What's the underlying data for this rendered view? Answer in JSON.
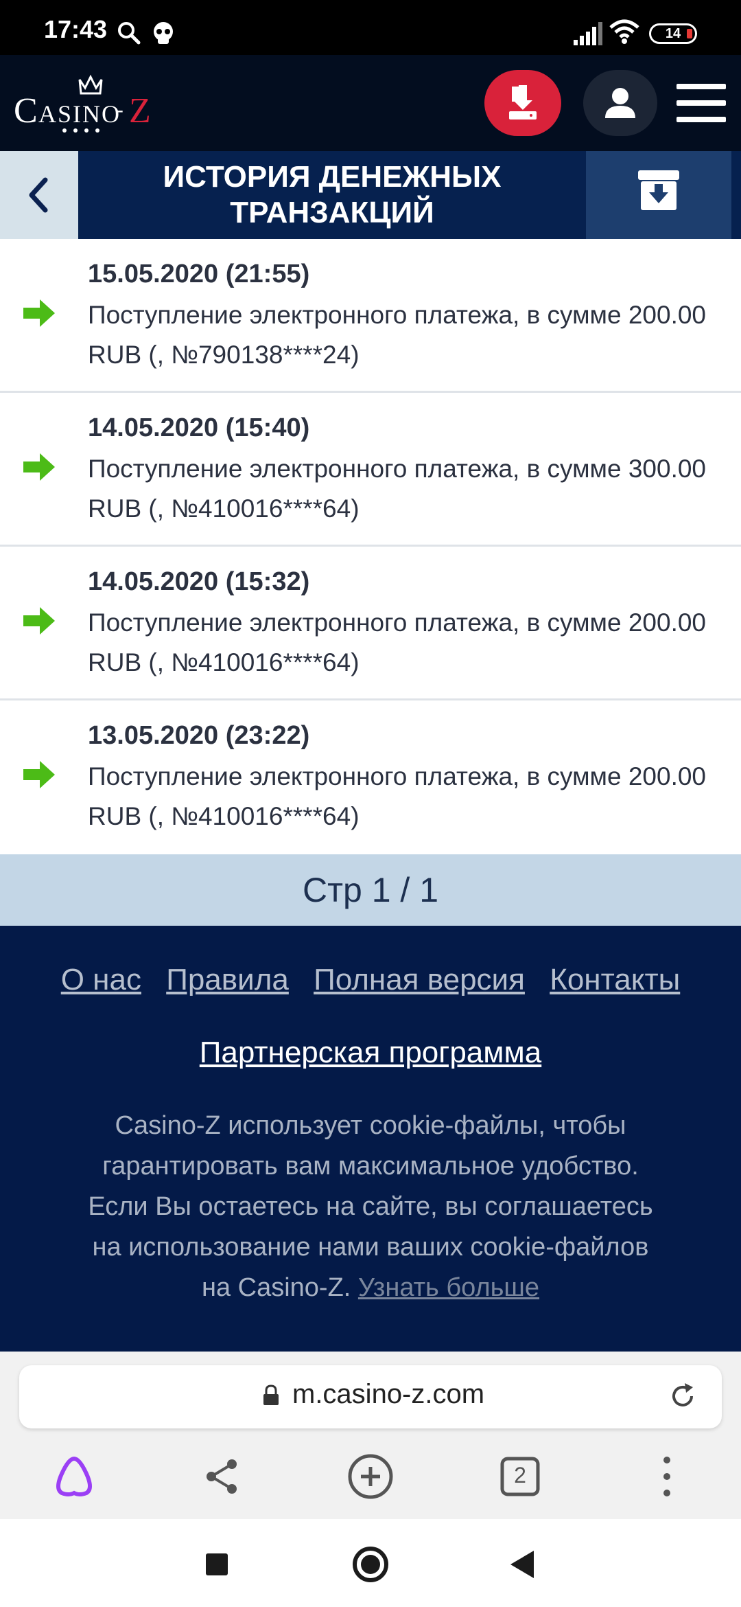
{
  "status_bar": {
    "time": "17:43",
    "battery": "14"
  },
  "header": {
    "logo_text": "CASINO-Z"
  },
  "page": {
    "title": "ИСТОРИЯ ДЕНЕЖНЫХ ТРАНЗАКЦИЙ"
  },
  "transactions": [
    {
      "date": "15.05.2020 (21:55)",
      "description": "Поступление электронного платежа, в сумме 200.00 RUB (, №790138****24)"
    },
    {
      "date": "14.05.2020 (15:40)",
      "description": "Поступление электронного платежа, в сумме 300.00 RUB (, №410016****64)"
    },
    {
      "date": "14.05.2020 (15:32)",
      "description": "Поступление электронного платежа, в сумме 200.00 RUB (, №410016****64)"
    },
    {
      "date": "13.05.2020 (23:22)",
      "description": "Поступление электронного платежа, в сумме 200.00 RUB (, №410016****64)"
    }
  ],
  "pagination": {
    "label": "Стр 1 / 1"
  },
  "footer": {
    "links": [
      "О нас",
      "Правила",
      "Полная версия",
      "Контакты"
    ],
    "partner": "Партнерская программа",
    "cookie_text": "Casino-Z использует cookie-файлы, чтобы гарантировать вам максимальное удобство. Если Вы остаетесь на сайте, вы соглашаетесь на использование нами ваших cookie-файлов на Casino-Z.",
    "cookie_more": "Узнать больше"
  },
  "browser": {
    "url": "m.casino-z.com",
    "tabs_count": "2"
  },
  "colors": {
    "header_bg": "#030d1f",
    "title_bg": "#06214f",
    "download_btn": "#d9223a",
    "arrow_green": "#4cbb17",
    "footer_bg": "#041a48",
    "pagination_bg": "#c3d6e6"
  }
}
